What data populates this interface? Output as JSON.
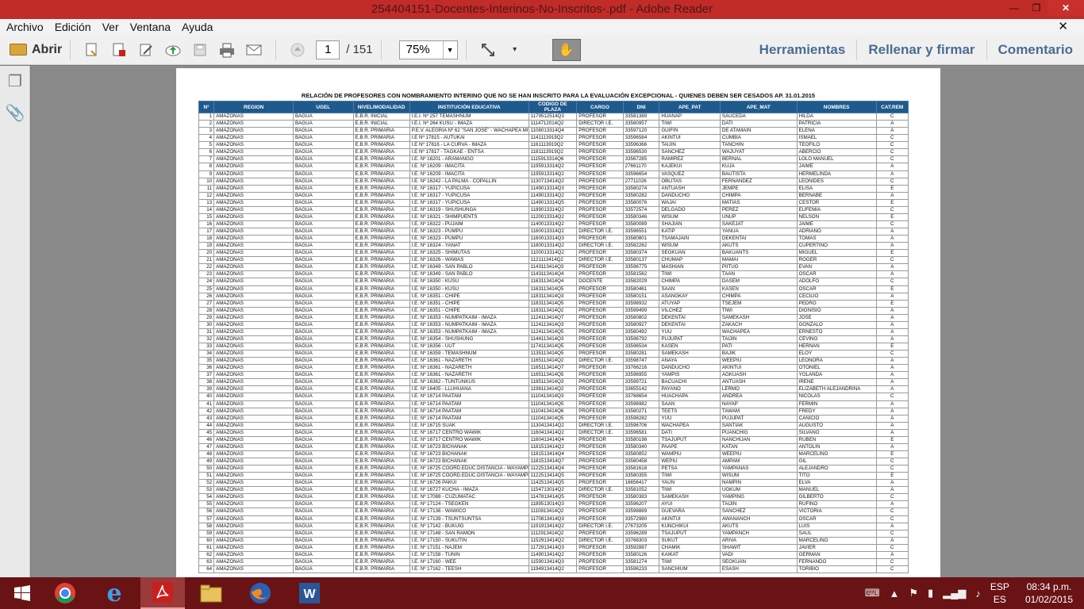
{
  "window": {
    "title": "254404151-Docentes-Interinos-No-Inscritos-.pdf - Adobe Reader",
    "minimize": "—",
    "maximize": "❐",
    "close": "✕"
  },
  "menu": {
    "items": [
      "Archivo",
      "Edición",
      "Ver",
      "Ventana",
      "Ayuda"
    ],
    "close_doc": "✕"
  },
  "toolbar": {
    "open_label": "Abrir",
    "page_current": "1",
    "page_total": "/ 151",
    "zoom": "75%",
    "tools_label": "Herramientas",
    "fill_sign_label": "Rellenar y firmar",
    "comment_label": "Comentario"
  },
  "document": {
    "title": "RELACIÓN DE PROFESORES CON NOMBRAMIENTO INTERINO QUE NO SE HAN INSCRITO PARA LA EVALUACIÓN EXCEPCIONAL - QUIENES DEBEN SER CESADOS AP. 31.01.2015",
    "headers": [
      "N°",
      "REGION",
      "UGEL",
      "NIVEL/MODALIDAD",
      "INSTITUCIÓN EDUCATIVA",
      "CODIGO DE PLAZA",
      "CARGO",
      "DNI",
      "APE_PAT",
      "APE_MAT",
      "NOMBRES",
      "CAT.REM"
    ],
    "rows": [
      [
        "1",
        "AMAZONAS",
        "BAGUA",
        "E.B.R. INICIAL",
        "I.E.I. Nº 257 TEMASHNUM",
        "1179512514Q3",
        "PROFESOR",
        "33581389",
        "HUAÑAP",
        "SAUCEDA",
        "HILDA",
        "C"
      ],
      [
        "2",
        "AMAZONAS",
        "BAGUA",
        "E.B.R. INICIAL",
        "I.E.I. Nº 264 KUSU - IMAZA",
        "1114712014Q2",
        "DIRECTOR I.E.",
        "33580957",
        "TIWI",
        "DATI",
        "PATRICIA",
        "A"
      ],
      [
        "3",
        "AMAZONAS",
        "BAGUA",
        "E.B.R. PRIMARIA",
        "P.E.V. ALEGRIA Nº 62 \"SAN JOSE\" - WACHAPEA MISION - IMAZA",
        "1108013314Q4",
        "PROFESOR",
        "33597120",
        "GUIFIN",
        "DE ATAMAIN",
        "ELENA",
        "A"
      ],
      [
        "4",
        "AMAZONAS",
        "BAGUA",
        "E.B.R. PRIMARIA",
        "I.E Nº 17815 - AUTUKAI",
        "1141113919Q2",
        "PROFESOR",
        "33596584",
        "AKINTUI",
        "CUMBIA",
        "ISMAEL",
        "C"
      ],
      [
        "5",
        "AMAZONAS",
        "BAGUA",
        "E.B.R. PRIMARIA",
        "I.E Nº 17816 - LA CURVA - IMAZA",
        "1161113919Q2",
        "PROFESOR",
        "33596366",
        "TAIJIN",
        "TANCHIN",
        "TEOFILO",
        "C"
      ],
      [
        "6",
        "AMAZONAS",
        "BAGUA",
        "E.B.R. PRIMARIA",
        "I.E Nº 17817 - TAGKAE - ENTSA",
        "1181113919Q2",
        "PROFESOR",
        "33596530",
        "SANCHEZ",
        "WAJUYAT",
        "ABERCIO",
        "C"
      ],
      [
        "7",
        "AMAZONAS",
        "BAGUA",
        "E.B.R. PRIMARIA",
        "I.E. Nº 16201 - ARAMANGO",
        "1115913314Q6",
        "PROFESOR",
        "33567285",
        "RAMIREZ",
        "BERNAL",
        "LOLO MANUEL",
        "C"
      ],
      [
        "8",
        "AMAZONAS",
        "BAGUA",
        "E.B.R. PRIMARIA",
        "I.E. Nº 16209 - IMACITA",
        "1195913314Q2",
        "PROFESOR",
        "27661170",
        "KAJEKUI",
        "KUJA",
        "JAIME",
        "A"
      ],
      [
        "9",
        "AMAZONAS",
        "BAGUA",
        "E.B.R. PRIMARIA",
        "I.E. Nº 16209 - IMACITA",
        "1195913314Q2",
        "PROFESOR",
        "33596654",
        "VASQUEZ",
        "BAUTISTA",
        "HERMELINDA",
        "A"
      ],
      [
        "10",
        "AMAZONAS",
        "BAGUA",
        "E.B.R. PRIMARIA",
        "I.E. Nº 16242 - LA PALMA - COPALLIN",
        "1130713414Q2",
        "PROFESOR",
        "27711026",
        "OBLITAS",
        "FERNANDEZ",
        "LEONIDES",
        "C"
      ],
      [
        "11",
        "AMAZONAS",
        "BAGUA",
        "E.B.R. PRIMARIA",
        "I.E. Nº 16317 - YUPICUSA",
        "1149013314Q3",
        "PROFESOR",
        "33580274",
        "ANTUASH",
        "JEMPE",
        "ELISA",
        "E"
      ],
      [
        "12",
        "AMAZONAS",
        "BAGUA",
        "E.B.R. PRIMARIA",
        "I.E. Nº 16317 - YUPICUSA",
        "1149013314Q2",
        "PROFESOR",
        "33580282",
        "DANDUCHO",
        "CHIMPA",
        "BERNABE",
        "A"
      ],
      [
        "13",
        "AMAZONAS",
        "BAGUA",
        "E.B.R. PRIMARIA",
        "I.E. Nº 16317 - YUPICUSA",
        "1149013314Q5",
        "PROFESOR",
        "33580076",
        "WAJAI",
        "MATIAS",
        "CESTOR",
        "E"
      ],
      [
        "14",
        "AMAZONAS",
        "BAGUA",
        "E.B.R. PRIMARIA",
        "I.E. Nº 16319 - SHUSHUNGA",
        "1189013314Q2",
        "PROFESOR",
        "33572574",
        "DELGADO",
        "PEREZ",
        "EUFEMIA",
        "C"
      ],
      [
        "15",
        "AMAZONAS",
        "BAGUA",
        "E.B.R. PRIMARIA",
        "I.E. Nº 16321 - SHIMPUENTS",
        "1120013314Q2",
        "PROFESOR",
        "33580346",
        "WISUM",
        "UNUP",
        "NELSON",
        "E"
      ],
      [
        "16",
        "AMAZONAS",
        "BAGUA",
        "E.B.R. PRIMARIA",
        "I.E. Nº 16322 - PUJAIM",
        "1140013314Q2",
        "PROFESOR",
        "33580089",
        "SHAJIAN",
        "SAKEJAT",
        "JAIME",
        "C"
      ],
      [
        "17",
        "AMAZONAS",
        "BAGUA",
        "E.B.R. PRIMARIA",
        "I.E. Nº 16323 - PUMPU",
        "1160013314Q2",
        "DIRECTOR I.E.",
        "33596551",
        "KATIP",
        "YANUA",
        "ADRIANO",
        "A"
      ],
      [
        "18",
        "AMAZONAS",
        "BAGUA",
        "E.B.R. PRIMARIA",
        "I.E. Nº 16323 - PUMPU",
        "1160013314Q3",
        "PROFESOR",
        "33580801",
        "TSAMAJAIN",
        "DEKENTAI",
        "TOMAS",
        "A"
      ],
      [
        "19",
        "AMAZONAS",
        "BAGUA",
        "E.B.R. PRIMARIA",
        "I.E. Nº 16324 - YANAT",
        "1180013314Q2",
        "DIRECTOR I.E.",
        "33582262",
        "WISUM",
        "AKUTS",
        "CUPERTINO",
        "A"
      ],
      [
        "20",
        "AMAZONAS",
        "BAGUA",
        "E.B.R. PRIMARIA",
        "I.E. Nº 16325 - SHIMUTAS",
        "1100013314Q2",
        "PROFESOR",
        "33580374",
        "SEGKUAN",
        "BAKUANTS",
        "MIGUEL",
        "E"
      ],
      [
        "21",
        "AMAZONAS",
        "BAGUA",
        "E.B.R. PRIMARIA",
        "I.E. Nº 16326 - WAWAS",
        "1121113414Q2",
        "DIRECTOR I.E.",
        "33580137",
        "CHUMAP",
        "MAMAI",
        "ROGER",
        "C"
      ],
      [
        "22",
        "AMAZONAS",
        "BAGUA",
        "E.B.R. PRIMARIA",
        "I.E. Nº 16349 - SAN PABLO",
        "1143113414Q3",
        "PROFESOR",
        "33596775",
        "MASHIAN",
        "PIITUG",
        "EVAN",
        "A"
      ],
      [
        "23",
        "AMAZONAS",
        "BAGUA",
        "E.B.R. PRIMARIA",
        "I.E. Nº 16349 - SAN PABLO",
        "1143113414Q4",
        "PROFESOR",
        "33581562",
        "TIWI",
        "TAAN",
        "OSCAR",
        "A"
      ],
      [
        "24",
        "AMAZONAS",
        "BAGUA",
        "E.B.R. PRIMARIA",
        "I.E. Nº 16350 - KUSU",
        "1163113414Q4",
        "DOCENTE",
        "33582029",
        "CHIMPA",
        "DASEM",
        "ADOLFO",
        "C"
      ],
      [
        "25",
        "AMAZONAS",
        "BAGUA",
        "E.B.R. PRIMARIA",
        "I.E. Nº 16350 - KUSU",
        "1163113414Q5",
        "PROFESOR",
        "33580461",
        "SAAN",
        "KASEN",
        "OSCAR",
        "E"
      ],
      [
        "26",
        "AMAZONAS",
        "BAGUA",
        "E.B.R. PRIMARIA",
        "I.E. Nº 16351 - CHIPE",
        "1183113414Q3",
        "PROFESOR",
        "33580151",
        "ASANGKAY",
        "CHIMPA",
        "CECILIO",
        "A"
      ],
      [
        "27",
        "AMAZONAS",
        "BAGUA",
        "E.B.R. PRIMARIA",
        "I.E. Nº 16351 - CHIPE",
        "1183113414Q5",
        "PROFESOR",
        "33598932",
        "ATUYAP",
        "TSEJEM",
        "PEDRO",
        "E"
      ],
      [
        "28",
        "AMAZONAS",
        "BAGUA",
        "E.B.R. PRIMARIA",
        "I.E. Nº 16351 - CHIPE",
        "1183113414Q2",
        "PROFESOR",
        "33599499",
        "VILCHEZ",
        "TIWI",
        "DIONISIO",
        "A"
      ],
      [
        "29",
        "AMAZONAS",
        "BAGUA",
        "E.B.R. PRIMARIA",
        "I.E. Nº 16353 - NUMPATKAIM - IMAZA",
        "1124113414Q7",
        "PROFESOR",
        "33580802",
        "DEKENTAI",
        "SAMEKASH",
        "JOSE",
        "A"
      ],
      [
        "30",
        "AMAZONAS",
        "BAGUA",
        "E.B.R. PRIMARIA",
        "I.E. Nº 16353 - NUMPATKAIM - IMAZA",
        "1124113414Q3",
        "PROFESOR",
        "33580927",
        "DEKENTAI",
        "ZAKACH",
        "GONZALO",
        "A"
      ],
      [
        "31",
        "AMAZONAS",
        "BAGUA",
        "E.B.R. PRIMARIA",
        "I.E. Nº 16353 - NUMPATKAIM - IMAZA",
        "1124113414Q5",
        "PROFESOR",
        "33580492",
        "YUU",
        "WACHAPEA",
        "ERNESTO",
        "A"
      ],
      [
        "32",
        "AMAZONAS",
        "BAGUA",
        "E.B.R. PRIMARIA",
        "I.E. Nº 16354 - SHUSHUNG",
        "1144113414Q3",
        "PROFESOR",
        "33596792",
        "PUJUPAT",
        "TAIJIN",
        "CEVINO",
        "A"
      ],
      [
        "33",
        "AMAZONAS",
        "BAGUA",
        "E.B.R. PRIMARIA",
        "I.E. Nº 16356 - UUT",
        "1174113414Q5",
        "PROFESOR",
        "33596534",
        "KASEN",
        "PATI",
        "HERNAN",
        "E"
      ],
      [
        "34",
        "AMAZONAS",
        "BAGUA",
        "E.B.R. PRIMARIA",
        "I.E. Nº 16359 - TEMASHNUM",
        "1135113414Q5",
        "PROFESOR",
        "33580281",
        "SAMEKASH",
        "BAJIK",
        "ELOY",
        "C"
      ],
      [
        "35",
        "AMAZONAS",
        "BAGUA",
        "E.B.R. PRIMARIA",
        "I.E. Nº 16361 - NAZARETH",
        "1165113414Q2",
        "DIRECTOR I.E.",
        "33598747",
        "ANAYA",
        "WEEPIU",
        "LEONORA",
        "A"
      ],
      [
        "36",
        "AMAZONAS",
        "BAGUA",
        "E.B.R. PRIMARIA",
        "I.E. Nº 16361 - NAZARETH",
        "1165113414Q7",
        "PROFESOR",
        "33766216",
        "DANDUCHO",
        "AKINTUI",
        "OTONIEL",
        "A"
      ],
      [
        "37",
        "AMAZONAS",
        "BAGUA",
        "E.B.R. PRIMARIA",
        "I.E. Nº 16361 - NAZARETH",
        "1165113414Q5",
        "PROFESOR",
        "33596955",
        "YAMPIS",
        "AGKUASH",
        "YOLANDA",
        "A"
      ],
      [
        "38",
        "AMAZONAS",
        "BAGUA",
        "E.B.R. PRIMARIA",
        "I.E. Nº 16362 - TUNTUNKUS",
        "1185113414Q3",
        "PROFESOR",
        "33599721",
        "BACUACHI",
        "ANTUASH",
        "IRENE",
        "A"
      ],
      [
        "39",
        "AMAZONAS",
        "BAGUA",
        "E.B.R. PRIMARIA",
        "I.E. Nº 16405 - LLUHUANA",
        "1198113414Q2",
        "PROFESOR",
        "33655142",
        "PAYANO",
        "LERMO",
        "ELIZABETH ALEJANDRINA",
        "A"
      ],
      [
        "40",
        "AMAZONAS",
        "BAGUA",
        "E.B.R. PRIMARIA",
        "I.E. Nº 16714 PAATAM",
        "1110413414Q3",
        "PROFESOR",
        "33768654",
        "HUACHAPA",
        "ANDREA",
        "NICOLAS",
        "C"
      ],
      [
        "41",
        "AMAZONAS",
        "BAGUA",
        "E.B.R. PRIMARIA",
        "I.E. Nº 16714 PAATAM",
        "1110413414Q5",
        "PROFESOR",
        "33596982",
        "SAAN",
        "NAYAP",
        "FERMIN",
        "A"
      ],
      [
        "42",
        "AMAZONAS",
        "BAGUA",
        "E.B.R. PRIMARIA",
        "I.E. Nº 16714 PAATAM",
        "1110413414Q6",
        "PROFESOR",
        "33580271",
        "TEETS",
        "TAWAM",
        "FREDY",
        "A"
      ],
      [
        "43",
        "AMAZONAS",
        "BAGUA",
        "E.B.R. PRIMARIA",
        "I.E. Nº 16714 PAATAM",
        "1110413414Q5",
        "PROFESOR",
        "33598282",
        "YUU",
        "PUJUPAT",
        "CANICIO",
        "A"
      ],
      [
        "44",
        "AMAZONAS",
        "BAGUA",
        "E.B.R. PRIMARIA",
        "I.E. Nº 16715 SUAK",
        "1130413414Q2",
        "DIRECTOR I.E.",
        "33596706",
        "WACHAPEA",
        "SANTIAK",
        "AUGUSTO",
        "A"
      ],
      [
        "45",
        "AMAZONAS",
        "BAGUA",
        "E.B.R. PRIMARIA",
        "I.E. Nº 16717 CENTRO WAWIK",
        "1160413414Q2",
        "DIRECTOR I.E.",
        "33596581",
        "DATI",
        "PUANCHIG",
        "SILVANO",
        "A"
      ],
      [
        "46",
        "AMAZONAS",
        "BAGUA",
        "E.B.R. PRIMARIA",
        "I.E. Nº 16717 CENTRO WAWIK",
        "1160413414Q4",
        "PROFESOR",
        "33580198",
        "TSAJUPUT",
        "NANCHIJAN",
        "RUBEN",
        "E"
      ],
      [
        "47",
        "AMAZONAS",
        "BAGUA",
        "E.B.R. PRIMARIA",
        "I.E. Nº 16723 BICHANAK",
        "1181513414Q2",
        "PROFESOR",
        "33580340",
        "PAAPE",
        "KATAN",
        "ANTOLIN",
        "A"
      ],
      [
        "48",
        "AMAZONAS",
        "BAGUA",
        "E.B.R. PRIMARIA",
        "I.E. Nº 16723 BICHANAK",
        "1181513414Q4",
        "PROFESOR",
        "33580852",
        "WAMPIU",
        "WEEPIU",
        "MARCELINO",
        "E"
      ],
      [
        "49",
        "AMAZONAS",
        "BAGUA",
        "E.B.R. PRIMARIA",
        "I.E. Nº 16723 BICHANAK",
        "1181513414Q7",
        "PROFESOR",
        "33580458",
        "WEPIU",
        "AMPAM",
        "GIL",
        "C"
      ],
      [
        "50",
        "AMAZONAS",
        "BAGUA",
        "E.B.R. PRIMARIA",
        "I.E. Nº 16725 COORD.EDUC.DISTANCIA - WAYAMPIAK",
        "1122513414Q4",
        "PROFESOR",
        "33581618",
        "PETSA",
        "YAMPANAS",
        "ALEJANDRO",
        "C"
      ],
      [
        "51",
        "AMAZONAS",
        "BAGUA",
        "E.B.R. PRIMARIA",
        "I.E. Nº 16725 COORD.EDUC.DISTANCIA - WAYAMPIAK",
        "1122513414Q5",
        "PROFESOR",
        "33580355",
        "TIWI",
        "WISUM",
        "TITO",
        "E"
      ],
      [
        "52",
        "AMAZONAS",
        "BAGUA",
        "E.B.R. PRIMARIA",
        "I.E. Nº 16726 PAKUI",
        "1142513414Q5",
        "PROFESOR",
        "16656417",
        "YAUN",
        "NAMPIN",
        "ELVA",
        "A"
      ],
      [
        "53",
        "AMAZONAS",
        "BAGUA",
        "E.B.R. PRIMARIA",
        "I.E. Nº 16727 KUCHA - IMAZA",
        "1154713014Q2",
        "DIRECTOR I.E.",
        "33581052",
        "TIWI",
        "UGKUM",
        "MANUEL",
        "A"
      ],
      [
        "54",
        "AMAZONAS",
        "BAGUA",
        "E.B.R. PRIMARIA",
        "I.E. Nº 17088 - CUZUMATAC",
        "1147813414Q5",
        "PROFESOR",
        "33580383",
        "SAMEKASH",
        "YAMPING",
        "GILBERTO",
        "C"
      ],
      [
        "55",
        "AMAZONAS",
        "BAGUA",
        "E.B.R. PRIMARIA",
        "I.E. Nº 17124 - TSEGKEN",
        "1189513014Q3",
        "PROFESOR",
        "33596207",
        "AYUI",
        "TAIJIN",
        "RUFINO",
        "A"
      ],
      [
        "56",
        "AMAZONAS",
        "BAGUA",
        "E.B.R. PRIMARIA",
        "I.E. Nº 17136 - WAWICO",
        "1110813414Q2",
        "PROFESOR",
        "33598889",
        "GUEVARA",
        "SANCHEZ",
        "VICTORIA",
        "C"
      ],
      [
        "57",
        "AMAZONAS",
        "BAGUA",
        "E.B.R. PRIMARIA",
        "I.E. Nº 17139 - TSUNTSUNTSA",
        "1170813414Q3",
        "PROFESOR",
        "33572980",
        "AKINTUI",
        "AWANANCH",
        "OSCAR",
        "C"
      ],
      [
        "58",
        "AMAZONAS",
        "BAGUA",
        "E.B.R. PRIMARIA",
        "I.E. Nº 17142 - BUKUIG",
        "1191913414Q2",
        "DIRECTOR I.E.",
        "27673205",
        "KUNCHIKUI",
        "AKUTS",
        "LUIS",
        "A"
      ],
      [
        "59",
        "AMAZONAS",
        "BAGUA",
        "E.B.R. PRIMARIA",
        "I.E. Nº 17148 - SAN RAMON",
        "1112913414Q2",
        "PROFESOR",
        "33596289",
        "TSAJUPUT",
        "YAMPANCH",
        "SAUL",
        "C"
      ],
      [
        "60",
        "AMAZONAS",
        "BAGUA",
        "E.B.R. PRIMARIA",
        "I.E. Nº 17150 - SUKUTIN",
        "1152913414Q2",
        "DIRECTOR I.E.",
        "33768303",
        "SUKUT",
        "ARIVA",
        "MARCELINO",
        "A"
      ],
      [
        "61",
        "AMAZONAS",
        "BAGUA",
        "E.B.R. PRIMARIA",
        "I.E. Nº 17151 - NAJEM",
        "1172913414Q3",
        "PROFESOR",
        "33592887",
        "CHAMIK",
        "SHAWIT",
        "JAVIER",
        "C"
      ],
      [
        "62",
        "AMAZONAS",
        "BAGUA",
        "E.B.R. PRIMARIA",
        "I.E. Nº 17158 - TUNIN",
        "1149013414Q2",
        "PROFESOR",
        "33580126",
        "KAIKAT",
        "VADI",
        "GERMAN",
        "A"
      ],
      [
        "63",
        "AMAZONAS",
        "BAGUA",
        "E.B.R. PRIMARIA",
        "I.E. Nº 17160 - WEE",
        "1159013414Q3",
        "PROFESOR",
        "33581274",
        "TIWI",
        "SEGKUAN",
        "FERNANDO",
        "C"
      ],
      [
        "64",
        "AMAZONAS",
        "BAGUA",
        "E.B.R. PRIMARIA",
        "I.E. Nº 17162 - TEESH",
        "1194913414Q2",
        "PROFESOR",
        "33596233",
        "SANCHIUM",
        "ESASH",
        "TORIBIO",
        "C"
      ]
    ]
  },
  "taskbar": {
    "lang_top": "ESP",
    "lang_bottom": "ES",
    "time": "08:34 p.m.",
    "date": "01/02/2015"
  },
  "colors": {
    "titlebar": "#c12b28",
    "taskbar": "#6a1314",
    "table_header": "#1f5a8c",
    "accent_text": "#4a6c93"
  }
}
